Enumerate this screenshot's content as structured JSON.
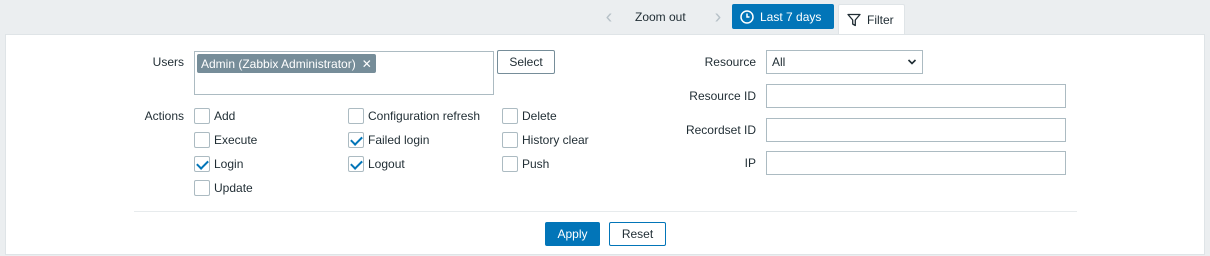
{
  "topbar": {
    "zoom_out": "Zoom out",
    "time_range": "Last 7 days",
    "filter_tab": "Filter"
  },
  "filter": {
    "users_label": "Users",
    "users_selected": [
      "Admin (Zabbix Administrator)"
    ],
    "select_button": "Select",
    "actions_label": "Actions",
    "actions": [
      {
        "label": "Add",
        "checked": false
      },
      {
        "label": "Configuration refresh",
        "checked": false
      },
      {
        "label": "Delete",
        "checked": false
      },
      {
        "label": "Execute",
        "checked": false
      },
      {
        "label": "Failed login",
        "checked": true
      },
      {
        "label": "History clear",
        "checked": false
      },
      {
        "label": "Login",
        "checked": true
      },
      {
        "label": "Logout",
        "checked": true
      },
      {
        "label": "Push",
        "checked": false
      },
      {
        "label": "Update",
        "checked": false
      }
    ],
    "resource_label": "Resource",
    "resource_value": "All",
    "resource_id_label": "Resource ID",
    "recordset_id_label": "Recordset ID",
    "ip_label": "IP",
    "resource_id_value": "",
    "recordset_id_value": "",
    "ip_value": "",
    "apply_button": "Apply",
    "reset_button": "Reset"
  },
  "colors": {
    "primary": "#0275b8",
    "tag_bg": "#768d99",
    "page_bg": "#ebeef0"
  }
}
